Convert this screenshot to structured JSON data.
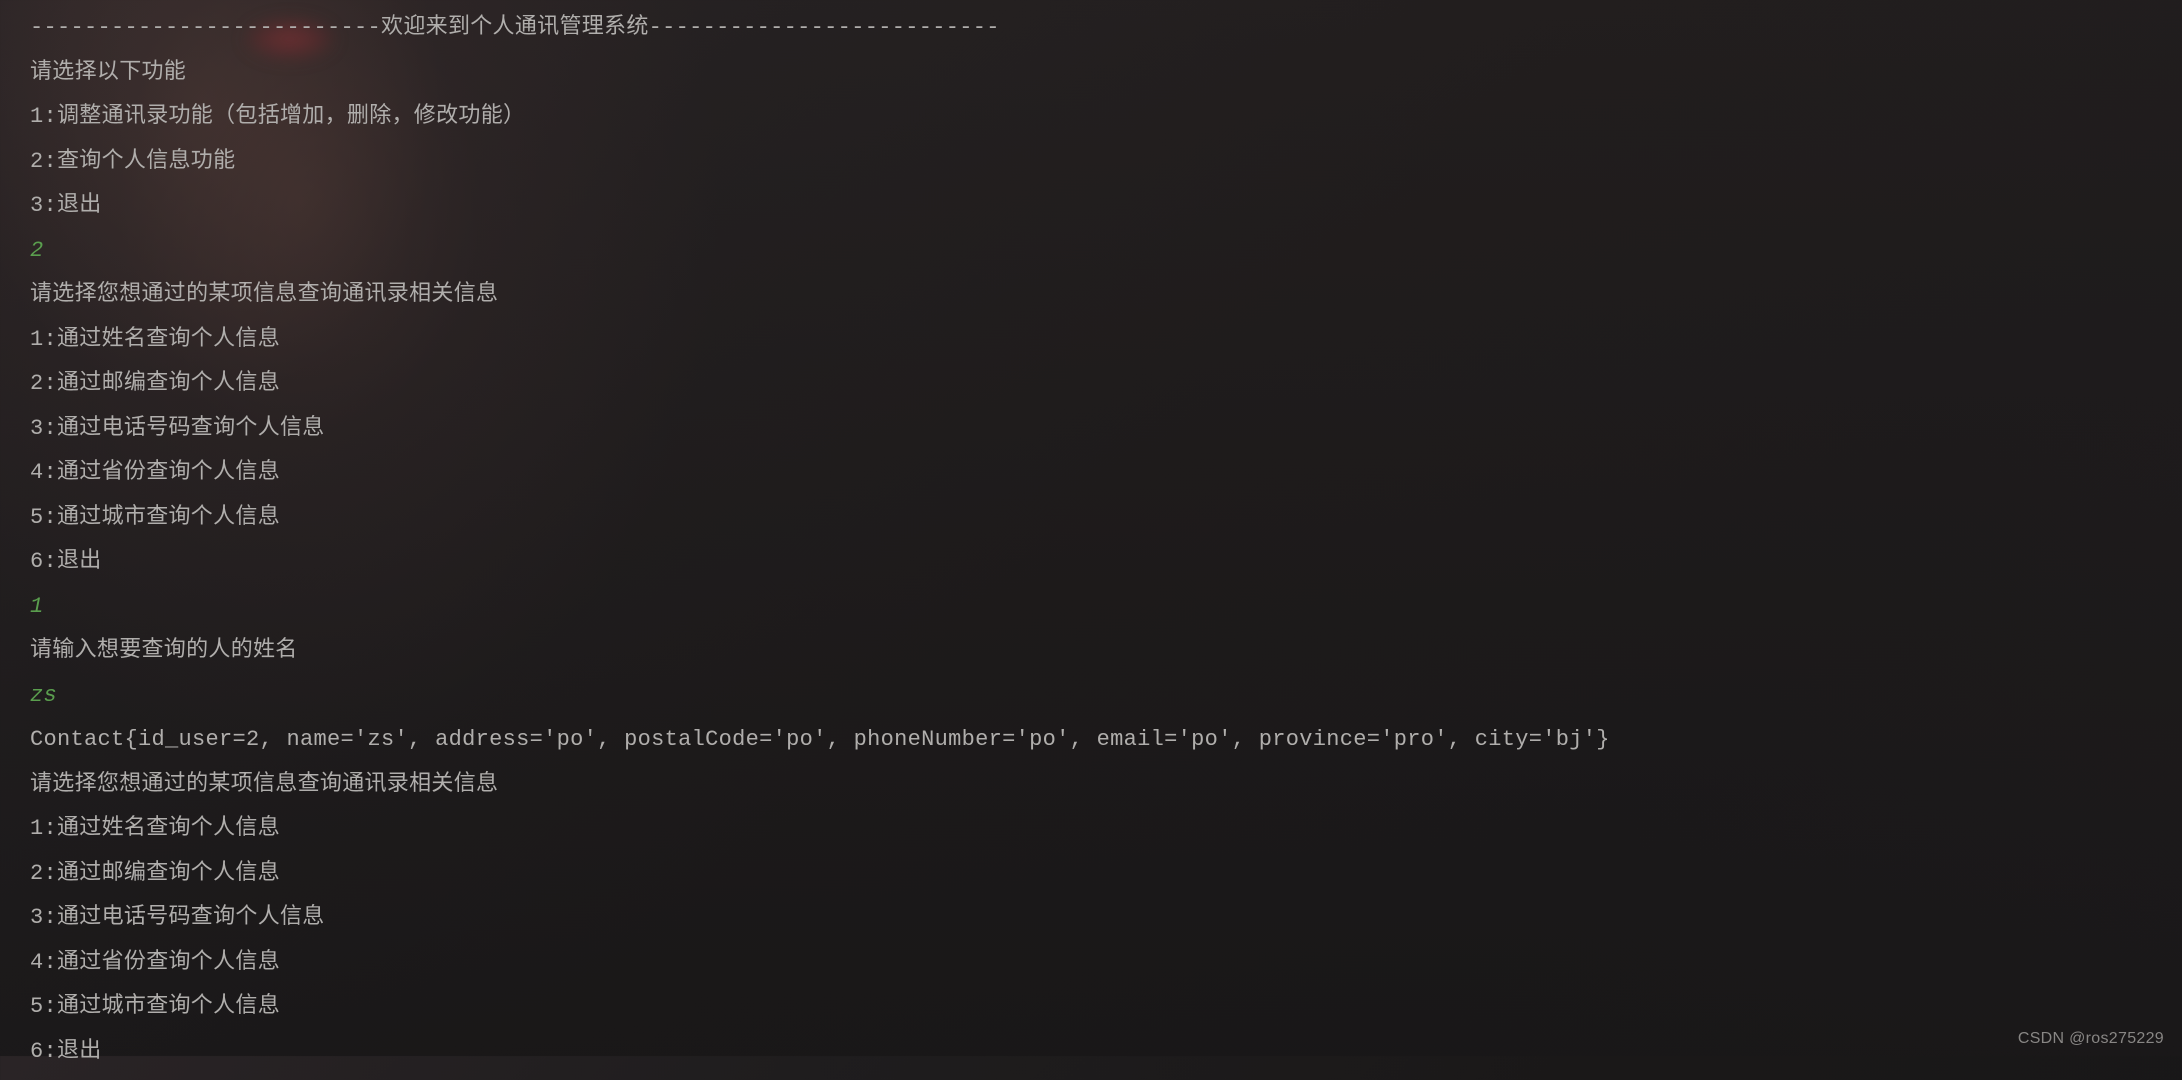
{
  "terminal": {
    "header": "--------------------------欢迎来到个人通讯管理系统--------------------------",
    "mainPrompt": "请选择以下功能",
    "mainMenu": {
      "opt1": "1:调整通讯录功能（包括增加，删除，修改功能）",
      "opt2": "2:查询个人信息功能",
      "opt3": "3:退出"
    },
    "input1": "2",
    "queryPrompt": "请选择您想通过的某项信息查询通讯录相关信息",
    "queryMenu": {
      "opt1": "1:通过姓名查询个人信息",
      "opt2": "2:通过邮编查询个人信息",
      "opt3": "3:通过电话号码查询个人信息",
      "opt4": "4:通过省份查询个人信息",
      "opt5": "5:通过城市查询个人信息",
      "opt6": "6:退出"
    },
    "input2": "1",
    "namePrompt": "请输入想要查询的人的姓名",
    "input3": "zs",
    "result": "Contact{id_user=2, name='zs', address='po', postalCode='po', phoneNumber='po', email='po', province='pro', city='bj'}",
    "queryPrompt2": "请选择您想通过的某项信息查询通讯录相关信息",
    "queryMenu2": {
      "opt1": "1:通过姓名查询个人信息",
      "opt2": "2:通过邮编查询个人信息",
      "opt3": "3:通过电话号码查询个人信息",
      "opt4": "4:通过省份查询个人信息",
      "opt5": "5:通过城市查询个人信息",
      "opt6": "6:退出"
    }
  },
  "watermark": "CSDN @ros275229"
}
